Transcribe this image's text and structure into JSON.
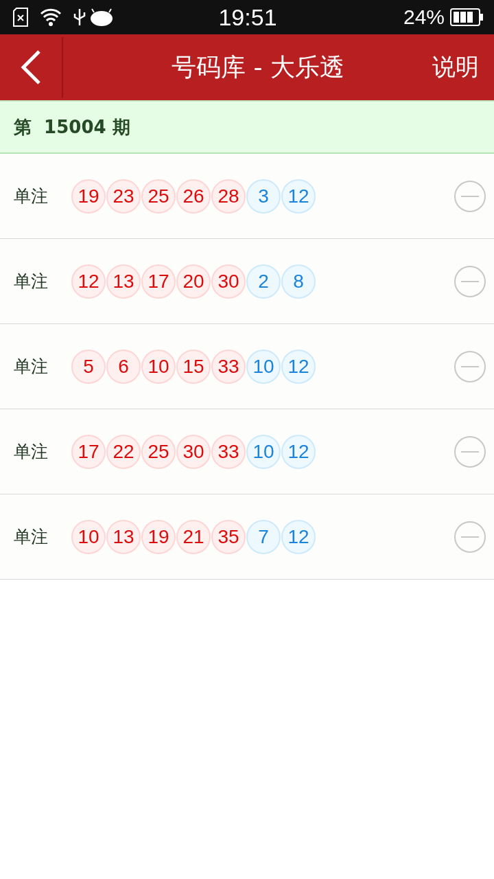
{
  "status_bar": {
    "time": "19:51",
    "battery": "24%"
  },
  "header": {
    "title": "号码库 - 大乐透",
    "action": "说明"
  },
  "issue": {
    "prefix": "第",
    "number": "15004",
    "suffix": "期"
  },
  "rows": [
    {
      "label": "单注",
      "balls": [
        {
          "kind": "front",
          "n": "19"
        },
        {
          "kind": "front",
          "n": "23"
        },
        {
          "kind": "front",
          "n": "25"
        },
        {
          "kind": "front",
          "n": "26"
        },
        {
          "kind": "front",
          "n": "28"
        },
        {
          "kind": "back",
          "n": "3"
        },
        {
          "kind": "back",
          "n": "12"
        }
      ]
    },
    {
      "label": "单注",
      "balls": [
        {
          "kind": "front",
          "n": "12"
        },
        {
          "kind": "front",
          "n": "13"
        },
        {
          "kind": "front",
          "n": "17"
        },
        {
          "kind": "front",
          "n": "20"
        },
        {
          "kind": "front",
          "n": "30"
        },
        {
          "kind": "back",
          "n": "2"
        },
        {
          "kind": "back",
          "n": "8"
        }
      ]
    },
    {
      "label": "单注",
      "balls": [
        {
          "kind": "front",
          "n": "5"
        },
        {
          "kind": "front",
          "n": "6"
        },
        {
          "kind": "front",
          "n": "10"
        },
        {
          "kind": "front",
          "n": "15"
        },
        {
          "kind": "front",
          "n": "33"
        },
        {
          "kind": "back",
          "n": "10"
        },
        {
          "kind": "back",
          "n": "12"
        }
      ]
    },
    {
      "label": "单注",
      "balls": [
        {
          "kind": "front",
          "n": "17"
        },
        {
          "kind": "front",
          "n": "22"
        },
        {
          "kind": "front",
          "n": "25"
        },
        {
          "kind": "front",
          "n": "30"
        },
        {
          "kind": "front",
          "n": "33"
        },
        {
          "kind": "back",
          "n": "10"
        },
        {
          "kind": "back",
          "n": "12"
        }
      ]
    },
    {
      "label": "单注",
      "balls": [
        {
          "kind": "front",
          "n": "10"
        },
        {
          "kind": "front",
          "n": "13"
        },
        {
          "kind": "front",
          "n": "19"
        },
        {
          "kind": "front",
          "n": "21"
        },
        {
          "kind": "front",
          "n": "35"
        },
        {
          "kind": "back",
          "n": "7"
        },
        {
          "kind": "back",
          "n": "12"
        }
      ]
    }
  ]
}
